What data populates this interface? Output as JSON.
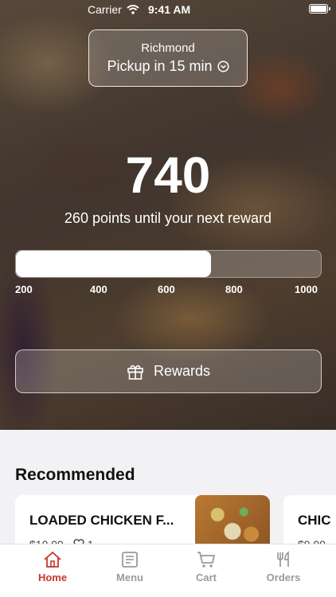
{
  "status_bar": {
    "carrier": "Carrier",
    "time": "9:41 AM"
  },
  "location": {
    "name": "Richmond",
    "pickup": "Pickup in 15 min"
  },
  "rewards": {
    "points": "740",
    "caption": "260 points until your next reward",
    "progress_fraction": 0.64,
    "ticks": [
      "200",
      "400",
      "600",
      "800",
      "1000"
    ],
    "button_label": "Rewards"
  },
  "recommended": {
    "title": "Recommended",
    "items": [
      {
        "name": "LOADED CHICKEN F...",
        "price": "$10.99",
        "likes": "1"
      },
      {
        "name": "CHIC",
        "price": "$9.99"
      }
    ]
  },
  "tabs": [
    {
      "label": "Home",
      "icon": "home-icon",
      "active": true
    },
    {
      "label": "Menu",
      "icon": "menu-icon",
      "active": false
    },
    {
      "label": "Cart",
      "icon": "cart-icon",
      "active": false
    },
    {
      "label": "Orders",
      "icon": "utensils-icon",
      "active": false
    }
  ],
  "colors": {
    "accent": "#c8372e",
    "inactive": "#9a9a9a"
  }
}
